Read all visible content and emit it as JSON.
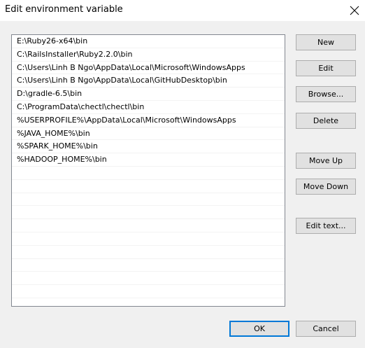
{
  "window": {
    "title": "Edit environment variable",
    "close_icon": "close-icon"
  },
  "path_list": {
    "items": [
      "E:\\Ruby26-x64\\bin",
      "C:\\RailsInstaller\\Ruby2.2.0\\bin",
      "C:\\Users\\Linh B Ngo\\AppData\\Local\\Microsoft\\WindowsApps",
      "C:\\Users\\Linh B Ngo\\AppData\\Local\\GitHubDesktop\\bin",
      "D:\\gradle-6.5\\bin",
      "C:\\ProgramData\\chectl\\chectl\\bin",
      "%USERPROFILE%\\AppData\\Local\\Microsoft\\WindowsApps",
      "%JAVA_HOME%\\bin",
      "%SPARK_HOME%\\bin",
      "%HADOOP_HOME%\\bin",
      "",
      "",
      "",
      "",
      "",
      "",
      "",
      "",
      "",
      "",
      ""
    ]
  },
  "buttons": {
    "new": "New",
    "edit": "Edit",
    "browse": "Browse...",
    "delete": "Delete",
    "move_up": "Move Up",
    "move_down": "Move Down",
    "edit_text": "Edit text...",
    "ok": "OK",
    "cancel": "Cancel"
  },
  "colors": {
    "default_button_border": "#0078d7",
    "button_face": "#e1e1e1",
    "dialog_background": "#f0f0f0"
  }
}
